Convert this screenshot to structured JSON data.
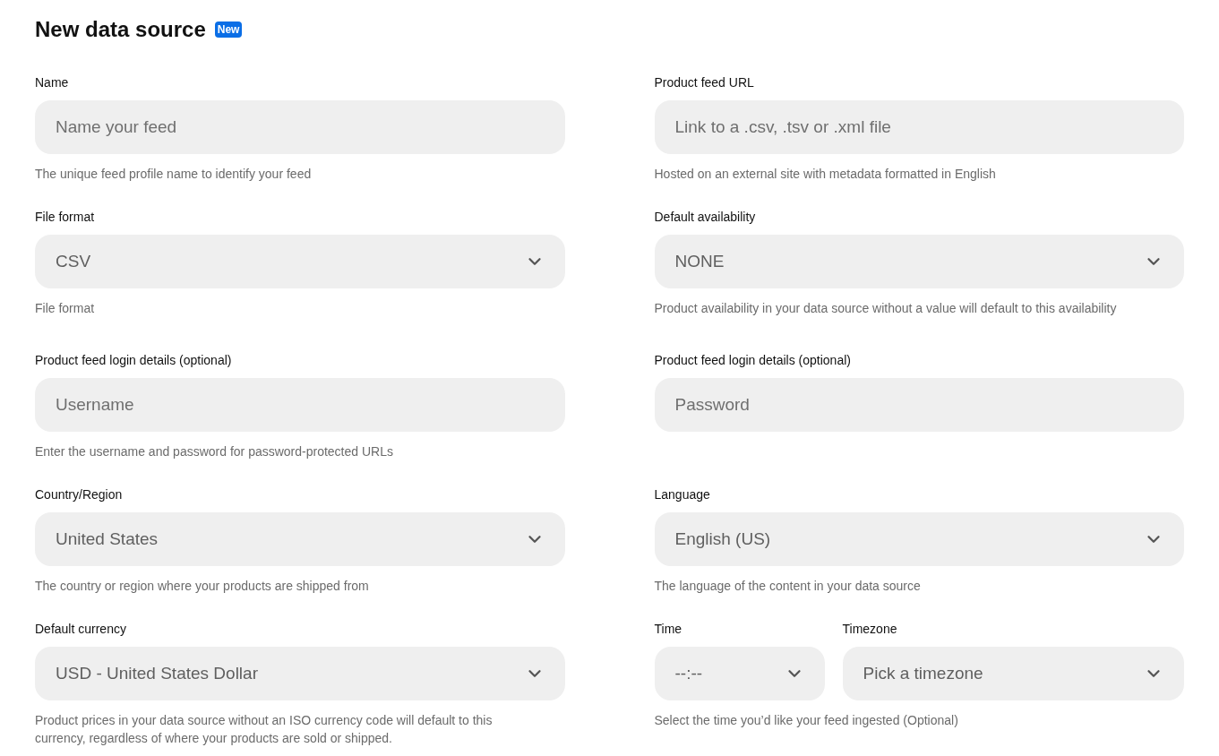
{
  "title": "New data source",
  "badge": "New",
  "cells": [
    {
      "fields": [
        {
          "label": "Name",
          "kind": "text",
          "placeholder": "Name your feed"
        }
      ],
      "help": "The unique feed profile name to identify your feed"
    },
    {
      "fields": [
        {
          "label": "Product feed URL",
          "kind": "text",
          "placeholder": "Link to a .csv, .tsv or .xml file"
        }
      ],
      "help": "Hosted on an external site with metadata formatted in English"
    },
    {
      "fields": [
        {
          "label": "File format",
          "kind": "select",
          "value": "CSV"
        }
      ],
      "help": "File format"
    },
    {
      "fields": [
        {
          "label": "Default availability",
          "kind": "select",
          "value": "NONE"
        }
      ],
      "help": "Product availability in your data source without a value will default to this availability"
    },
    {
      "fields": [
        {
          "label": "Product feed login details (optional)",
          "kind": "text",
          "placeholder": "Username"
        }
      ],
      "help": "Enter the username and password for password-protected URLs"
    },
    {
      "fields": [
        {
          "label": "Product feed login details (optional)",
          "kind": "text",
          "placeholder": "Password"
        }
      ]
    },
    {
      "fields": [
        {
          "label": "Country/Region",
          "kind": "select",
          "value": "United States"
        }
      ],
      "help": "The country or region where your products are shipped from"
    },
    {
      "fields": [
        {
          "label": "Language",
          "kind": "select",
          "value": "English (US)"
        }
      ],
      "help": "The language of the content in your data source"
    },
    {
      "fields": [
        {
          "label": "Default currency",
          "kind": "select",
          "value": "USD - United States Dollar"
        }
      ],
      "help": "Product prices in your data source without an ISO currency code will default to this currency, regardless of where your products are sold or shipped."
    },
    {
      "fields": [
        {
          "label": "Time",
          "kind": "select",
          "value": "--:--"
        },
        {
          "label": "Timezone",
          "kind": "select",
          "value": "Pick a timezone"
        }
      ],
      "help": "Select the time you’d like your feed ingested (Optional)"
    }
  ]
}
